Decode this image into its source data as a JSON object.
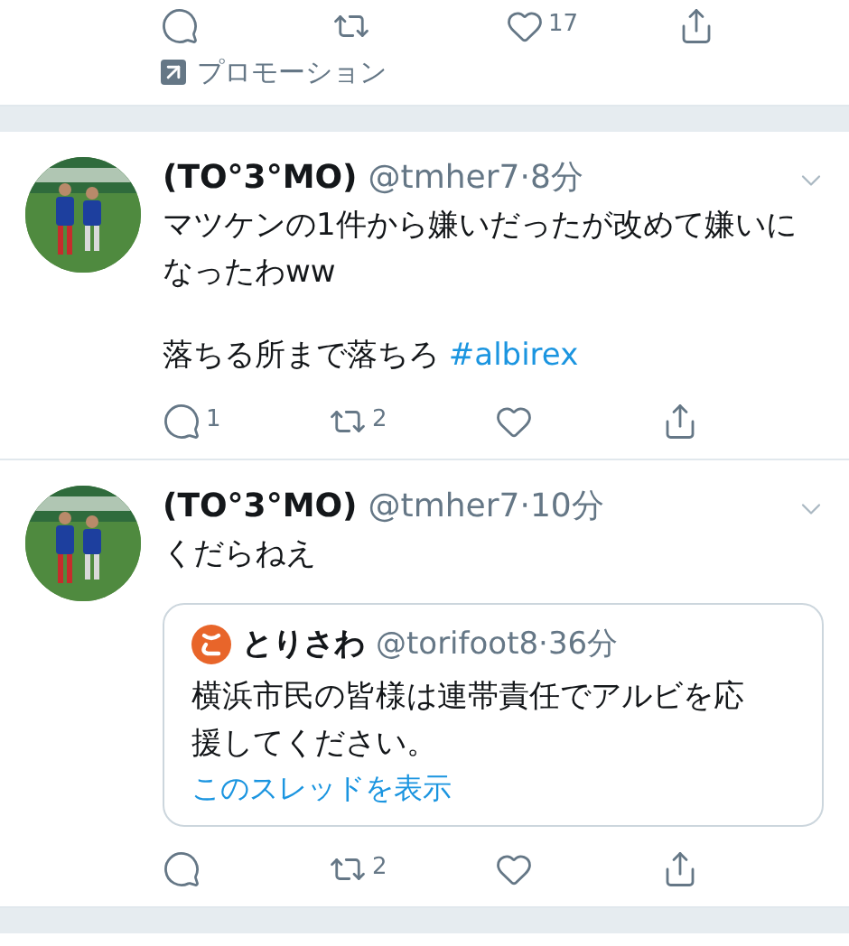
{
  "top_tweet": {
    "actions": [
      {
        "kind": "reply"
      },
      {
        "kind": "retweet"
      },
      {
        "kind": "like",
        "count": "17"
      },
      {
        "kind": "share"
      }
    ],
    "promotion": "プロモーション"
  },
  "tweets": [
    {
      "name": "(TO°3°MO)",
      "handle": "@tmher7",
      "time": "·8分",
      "paragraphs": [
        {
          "text": "マツケンの1件から嫌いだったが改めて嫌いになったわww"
        },
        {
          "text": "落ちる所まで落ちろ",
          "hashtag": "#albirex"
        }
      ],
      "actions": [
        {
          "kind": "reply",
          "count": "1"
        },
        {
          "kind": "retweet",
          "count": "2"
        },
        {
          "kind": "like"
        },
        {
          "kind": "share"
        }
      ]
    },
    {
      "name": "(TO°3°MO)",
      "handle": "@tmher7",
      "time": "·10分",
      "paragraphs": [
        {
          "text": "くだらねえ"
        }
      ],
      "quote": {
        "name": "とりさわ",
        "handle": "@torifoot8",
        "time": "·36分",
        "text": "横浜市民の皆様は連帯責任でアルビを応援してください。",
        "link": "このスレッドを表示"
      },
      "actions": [
        {
          "kind": "reply"
        },
        {
          "kind": "retweet",
          "count": "2"
        },
        {
          "kind": "like"
        },
        {
          "kind": "share"
        }
      ]
    }
  ]
}
